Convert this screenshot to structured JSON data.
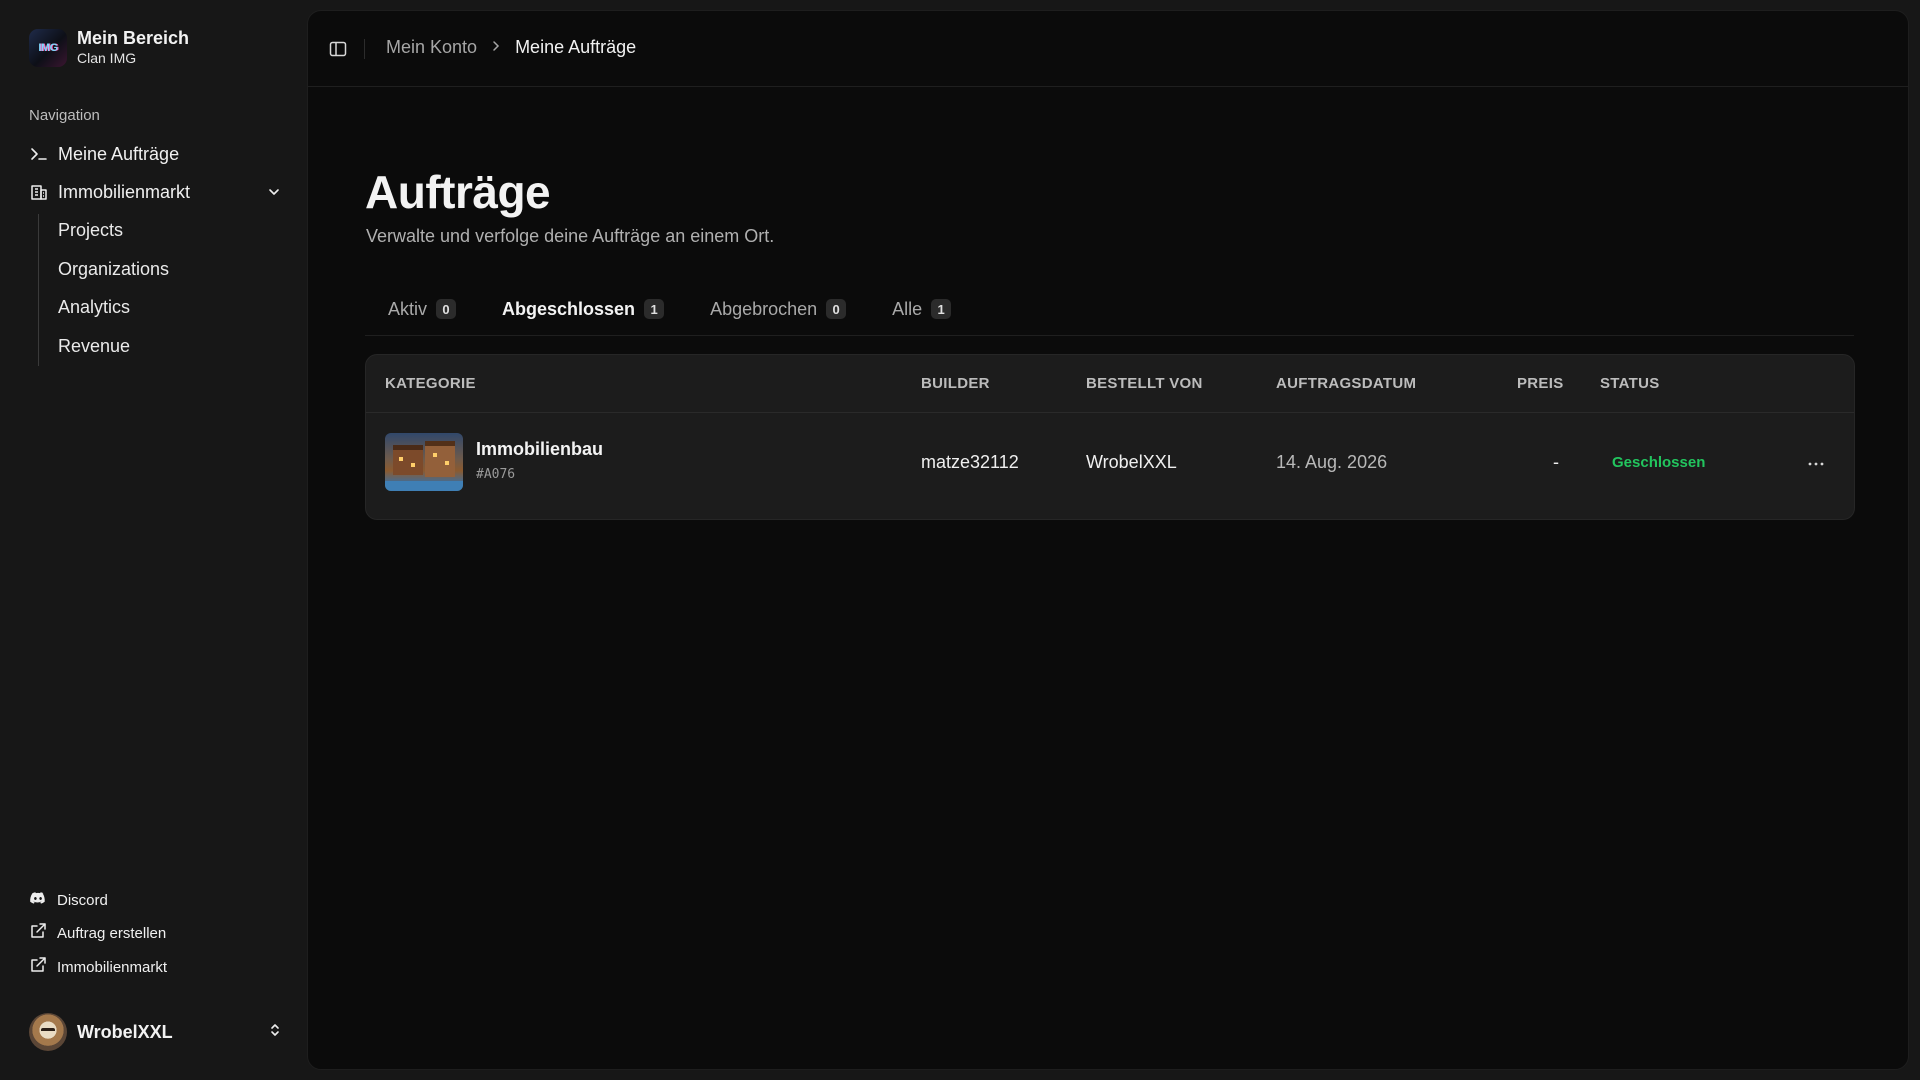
{
  "brand": {
    "logo_text": "IMG",
    "title": "Mein Bereich",
    "subtitle": "Clan IMG"
  },
  "sidebar": {
    "group_label": "Navigation",
    "items": [
      {
        "label": "Meine Aufträge",
        "icon": "terminal-icon"
      },
      {
        "label": "Immobilienmarkt",
        "icon": "building-icon",
        "expanded": true,
        "children": [
          "Projects",
          "Organizations",
          "Analytics",
          "Revenue"
        ]
      }
    ],
    "footer_links": [
      {
        "label": "Discord",
        "icon": "discord-icon"
      },
      {
        "label": "Auftrag erstellen",
        "icon": "external-link-icon"
      },
      {
        "label": "Immobilienmarkt",
        "icon": "external-link-icon"
      }
    ],
    "user": {
      "name": "WrobelXXL"
    }
  },
  "breadcrumb": {
    "parent": "Mein Konto",
    "current": "Meine Aufträge"
  },
  "page": {
    "title": "Aufträge",
    "subtitle": "Verwalte und verfolge deine Aufträge an einem Ort."
  },
  "tabs": [
    {
      "label": "Aktiv",
      "count": "0",
      "active": false
    },
    {
      "label": "Abgeschlossen",
      "count": "1",
      "active": true
    },
    {
      "label": "Abgebrochen",
      "count": "0",
      "active": false
    },
    {
      "label": "Alle",
      "count": "1",
      "active": false
    }
  ],
  "table": {
    "headers": {
      "kategorie": "KATEGORIE",
      "builder": "BUILDER",
      "bestellt_von": "BESTELLT VON",
      "auftragsdatum": "AUFTRAGSDATUM",
      "preis": "PREIS",
      "status": "STATUS"
    },
    "rows": [
      {
        "title": "Immobilienbau",
        "id": "#A076",
        "builder": "matze32112",
        "bestellt_von": "WrobelXXL",
        "datum": "14. Aug. 2026",
        "preis": "-",
        "status": "Geschlossen"
      }
    ]
  },
  "colors": {
    "status_closed": "#22c55e",
    "background": "#0b0b0b",
    "sidebar": "#171717"
  }
}
